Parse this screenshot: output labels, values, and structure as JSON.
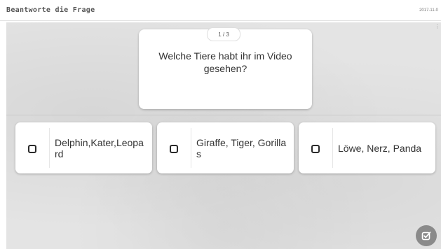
{
  "header": {
    "title": "Beantworte die Frage",
    "date": "2017-11-0"
  },
  "question": {
    "counter": "1 / 3",
    "text": "Welche Tiere habt ihr im Video gesehen?"
  },
  "answers": [
    {
      "label": "Delphin,Kater,Leopard",
      "checked": false
    },
    {
      "label": "Giraffe, Tiger, Gorillas",
      "checked": false
    },
    {
      "label": "Löwe, Nerz, Panda",
      "checked": false
    }
  ],
  "submit": {
    "icon": "check-square-icon"
  },
  "colors": {
    "stage_background": "#e4e4e4",
    "card": "#ffffff",
    "submit_button": "#8a8a8a"
  }
}
